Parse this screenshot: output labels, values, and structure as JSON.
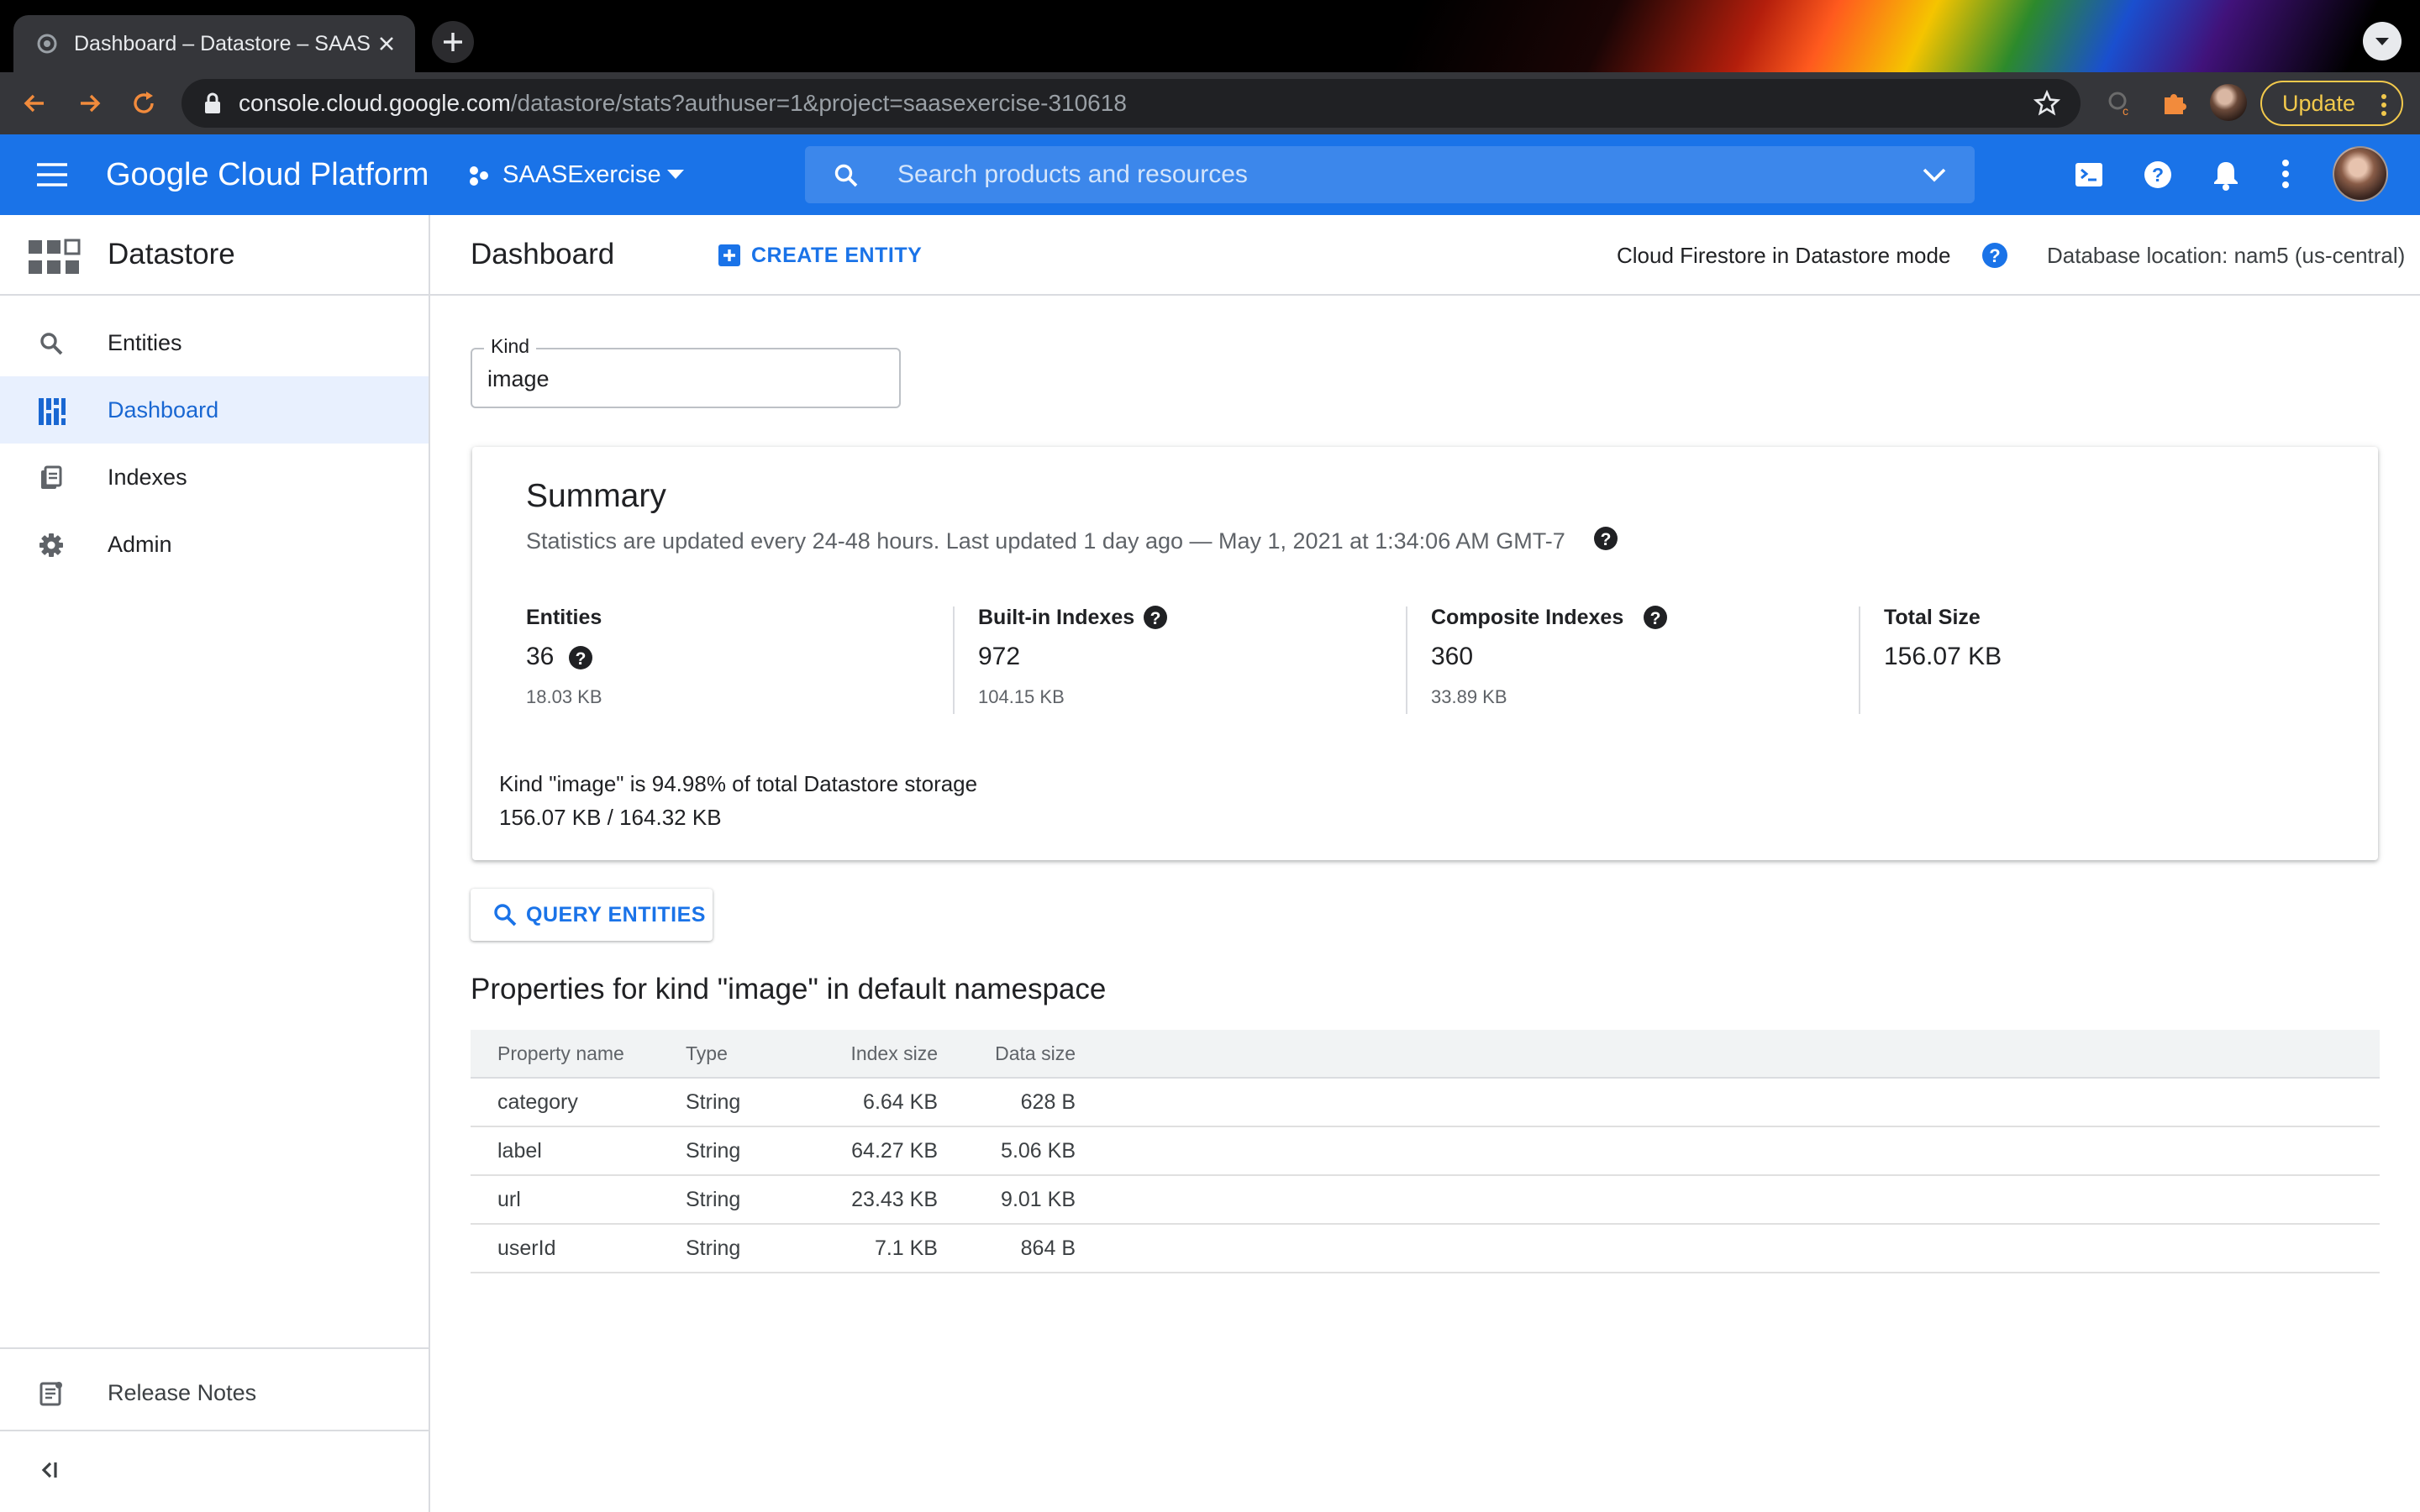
{
  "browser": {
    "tab_title": "Dashboard – Datastore – SAAS",
    "url_host": "console.cloud.google.com",
    "url_path": "/datastore/stats?authuser=1&project=saasexercise-310618",
    "update_label": "Update"
  },
  "header": {
    "title": "Google Cloud Platform",
    "project_name": "SAASExercise",
    "search_placeholder": "Search products and resources"
  },
  "nav": {
    "product": "Datastore",
    "items": [
      {
        "label": "Entities",
        "icon": "search-icon"
      },
      {
        "label": "Dashboard",
        "icon": "dashboard-icon",
        "active": true
      },
      {
        "label": "Indexes",
        "icon": "indexes-icon"
      },
      {
        "label": "Admin",
        "icon": "gear-icon"
      }
    ],
    "release_notes": "Release Notes"
  },
  "page": {
    "title": "Dashboard",
    "create_entity": "CREATE ENTITY",
    "db_mode": "Cloud Firestore in Datastore mode",
    "db_location": "Database location: nam5 (us-central)"
  },
  "kind": {
    "label": "Kind",
    "value": "image"
  },
  "summary": {
    "title": "Summary",
    "subtitle": "Statistics are updated every 24-48 hours. Last updated 1 day ago — May 1, 2021 at 1:34:06 AM GMT-7",
    "stats": {
      "entities": {
        "label": "Entities",
        "value": "36",
        "size": "18.03 KB"
      },
      "builtin": {
        "label": "Built-in Indexes",
        "value": "972",
        "size": "104.15 KB"
      },
      "composite": {
        "label": "Composite Indexes",
        "value": "360",
        "size": "33.89 KB"
      },
      "total": {
        "label": "Total Size",
        "value": "156.07 KB"
      }
    },
    "storage_pct": "Kind \"image\" is 94.98% of total Datastore storage",
    "storage_ratio": "156.07 KB / 164.32 KB"
  },
  "query_button": "QUERY ENTITIES",
  "properties": {
    "heading": "Properties for kind \"image\" in default namespace",
    "columns": [
      "Property name",
      "Type",
      "Index size",
      "Data size"
    ],
    "rows": [
      [
        "category",
        "String",
        "6.64 KB",
        "628 B"
      ],
      [
        "label",
        "String",
        "64.27 KB",
        "5.06 KB"
      ],
      [
        "url",
        "String",
        "23.43 KB",
        "9.01 KB"
      ],
      [
        "userId",
        "String",
        "7.1 KB",
        "864 B"
      ]
    ]
  },
  "colors": {
    "brand_blue": "#1a73e8",
    "active_bg": "#e8f0fe",
    "active_text": "#1967d2"
  }
}
